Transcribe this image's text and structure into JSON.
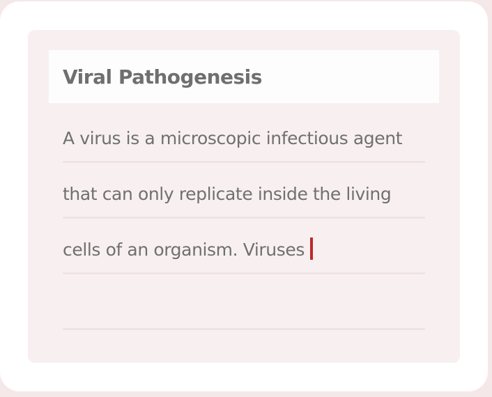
{
  "editor": {
    "title": "Viral Pathogenesis",
    "lines": [
      "A virus is a microscopic infectious agent",
      "that can only replicate inside the living",
      "cells of an organism. Viruses",
      ""
    ]
  },
  "colors": {
    "cursor": "#c0272d",
    "text": "#707070",
    "panel": "#f8f0f0"
  }
}
